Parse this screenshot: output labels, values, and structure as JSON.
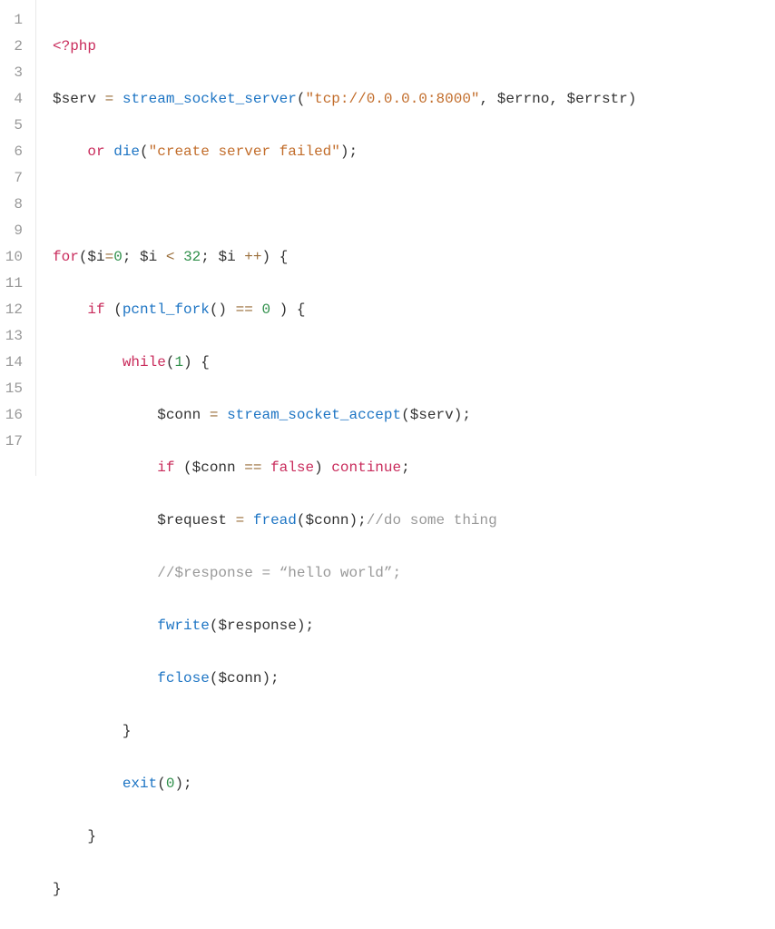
{
  "line_numbers": [
    "1",
    "2",
    "3",
    "4",
    "5",
    "6",
    "7",
    "8",
    "9",
    "10",
    "11",
    "12",
    "13",
    "14",
    "15",
    "16",
    "17"
  ],
  "tokens": {
    "php_open": "<?php",
    "var_serv": "$serv",
    "eq": "=",
    "fn_stream_socket_server": "stream_socket_server",
    "str_tcp": "\"tcp://0.0.0.0:8000\"",
    "var_errno": "$errno",
    "var_errstr": "$errstr",
    "kw_or": "or",
    "fn_die": "die",
    "str_create_failed": "\"create server failed\"",
    "kw_for": "for",
    "var_i": "$i",
    "num_0": "0",
    "op_lt": "<",
    "num_32": "32",
    "op_pp": "++",
    "kw_if": "if",
    "fn_pcntl_fork": "pcntl_fork",
    "op_eqeq": "==",
    "kw_while": "while",
    "num_1": "1",
    "var_conn": "$conn",
    "fn_stream_socket_accept": "stream_socket_accept",
    "bool_false": "false",
    "kw_continue": "continue",
    "var_request": "$request",
    "fn_fread": "fread",
    "cmt_do": "//do some thing",
    "cmt_response": "//$response = “hello world”;",
    "fn_fwrite": "fwrite",
    "var_response": "$response",
    "fn_fclose": "fclose",
    "kw_exit": "exit"
  }
}
